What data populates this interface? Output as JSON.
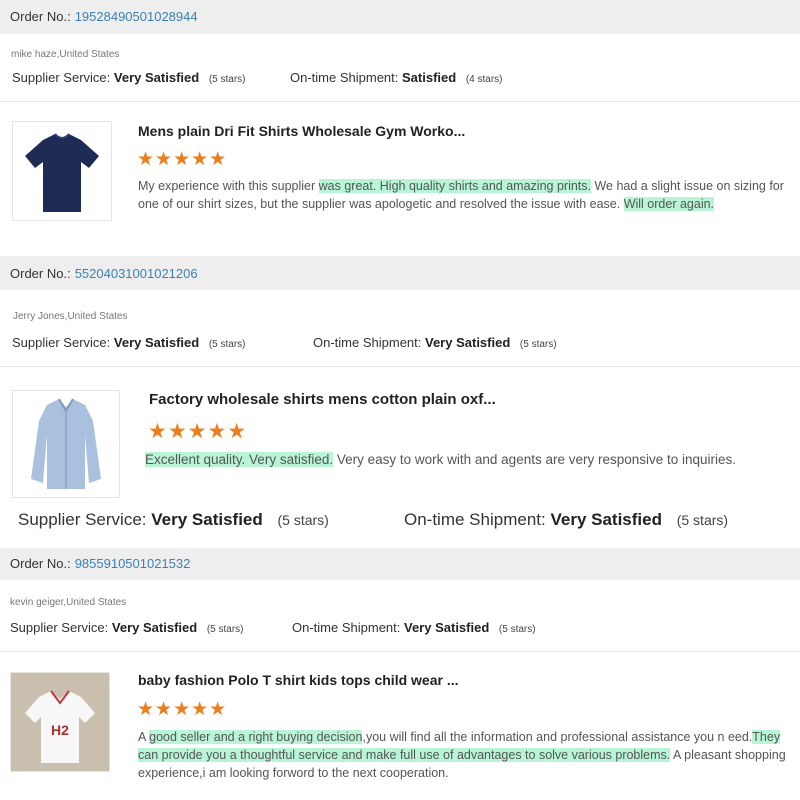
{
  "reviews": [
    {
      "order_label": "Order No.:",
      "order_number": "19528490501028944",
      "user": "mike haze,United States",
      "supplier_label": "Supplier Service:",
      "supplier_value": "Very Satisfied",
      "supplier_stars": "(5 stars)",
      "shipment_label": "On-time Shipment:",
      "shipment_value": "Satisfied",
      "shipment_stars": "(4 stars)",
      "product_icon": "navy-tshirt-image",
      "product_title": "Mens plain Dri Fit Shirts Wholesale Gym Worko...",
      "rating": "★★★★★",
      "review_parts": [
        {
          "text": "My experience with this supplier ",
          "hl": false
        },
        {
          "text": "was great. High quality shirts and amazing prints.",
          "hl": true
        },
        {
          "text": " We had a slight issue on sizing for one of our shirt sizes, but the supplier was apologetic and resolved the issue with ease. ",
          "hl": false
        },
        {
          "text": "Will order again.",
          "hl": true
        }
      ]
    },
    {
      "order_label": "Order No.:",
      "order_number": "55204031001021206",
      "user": "Jerry Jones,United States",
      "supplier_label": "Supplier Service:",
      "supplier_value": "Very Satisfied",
      "supplier_stars": "(5 stars)",
      "shipment_label": "On-time Shipment:",
      "shipment_value": "Very Satisfied",
      "shipment_stars": "(5 stars)",
      "product_icon": "blue-oxford-shirt-image",
      "product_title": "Factory wholesale shirts mens cotton plain oxf...",
      "rating": "★★★★★",
      "review_parts": [
        {
          "text": "Excellent quality. Very satisfied.",
          "hl": true
        },
        {
          "text": " Very easy to work with and agents are very responsive to inquiries.",
          "hl": false
        }
      ],
      "big_supplier_label": "Supplier Service:",
      "big_supplier_value": "Very Satisfied",
      "big_supplier_stars": "(5 stars)",
      "big_shipment_label": "On-time Shipment:",
      "big_shipment_value": "Very Satisfied",
      "big_shipment_stars": "(5 stars)"
    },
    {
      "order_label": "Order No.:",
      "order_number": "9855910501021532",
      "user": "kevin geiger,United States",
      "supplier_label": "Supplier Service:",
      "supplier_value": "Very Satisfied",
      "supplier_stars": "(5 stars)",
      "shipment_label": "On-time Shipment:",
      "shipment_value": "Very Satisfied",
      "shipment_stars": "(5 stars)",
      "product_icon": "white-kids-polo-image",
      "product_title": "baby fashion Polo T shirt kids tops child wear ...",
      "rating": "★★★★★",
      "review_parts": [
        {
          "text": "A ",
          "hl": false
        },
        {
          "text": "good seller and a right buying decision",
          "hl": true
        },
        {
          "text": ",you will find all the information and professional assistance you n eed.",
          "hl": false
        },
        {
          "text": "They can provide you a thoughtful service and make full use of advantages to solve various problems.",
          "hl": true
        },
        {
          "text": " A pleasant shopping experience,i am looking forword to the next cooperation.",
          "hl": false
        }
      ]
    }
  ]
}
